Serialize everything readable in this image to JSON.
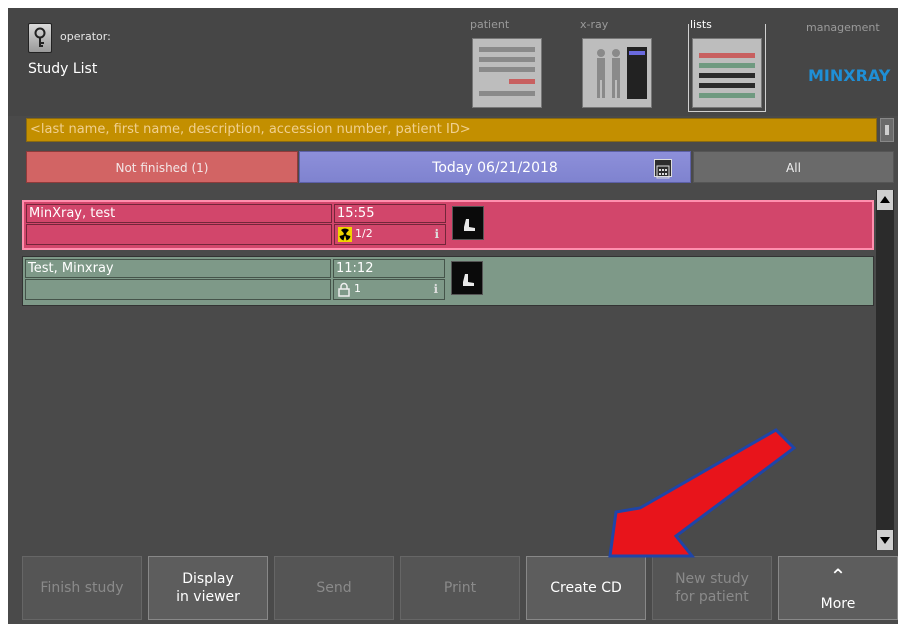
{
  "header": {
    "operator_label": "operator:",
    "screen_title": "Study List",
    "tabs": [
      {
        "label": "patient"
      },
      {
        "label": "x-ray"
      },
      {
        "label": "lists"
      },
      {
        "label": "management"
      }
    ],
    "logo_text": "MINXRAY"
  },
  "search": {
    "placeholder": "<last name, first name, description, accession number, patient ID>"
  },
  "filters": {
    "not_finished": "Not finished (1)",
    "today": "Today 06/21/2018",
    "all": "All"
  },
  "studies": [
    {
      "name": "MinXray, test",
      "time": "15:55",
      "status_text": "1/2",
      "row_color": "#d2466b",
      "status_icon": "radiation-icon"
    },
    {
      "name": "Test, Minxray",
      "time": "11:12",
      "status_text": "1",
      "row_color": "#7e9988",
      "status_icon": "lock-icon"
    }
  ],
  "buttons": {
    "finish_study": "Finish study",
    "display_in_viewer": "Display\nin viewer",
    "send": "Send",
    "print": "Print",
    "create_cd": "Create CD",
    "new_study": "New study\nfor patient",
    "more": "More"
  },
  "colors": {
    "search_bg": "#c38f00",
    "not_finished_bg": "#d26464",
    "today_bg": "#8387d2",
    "annotation_arrow": "#e8141b"
  }
}
